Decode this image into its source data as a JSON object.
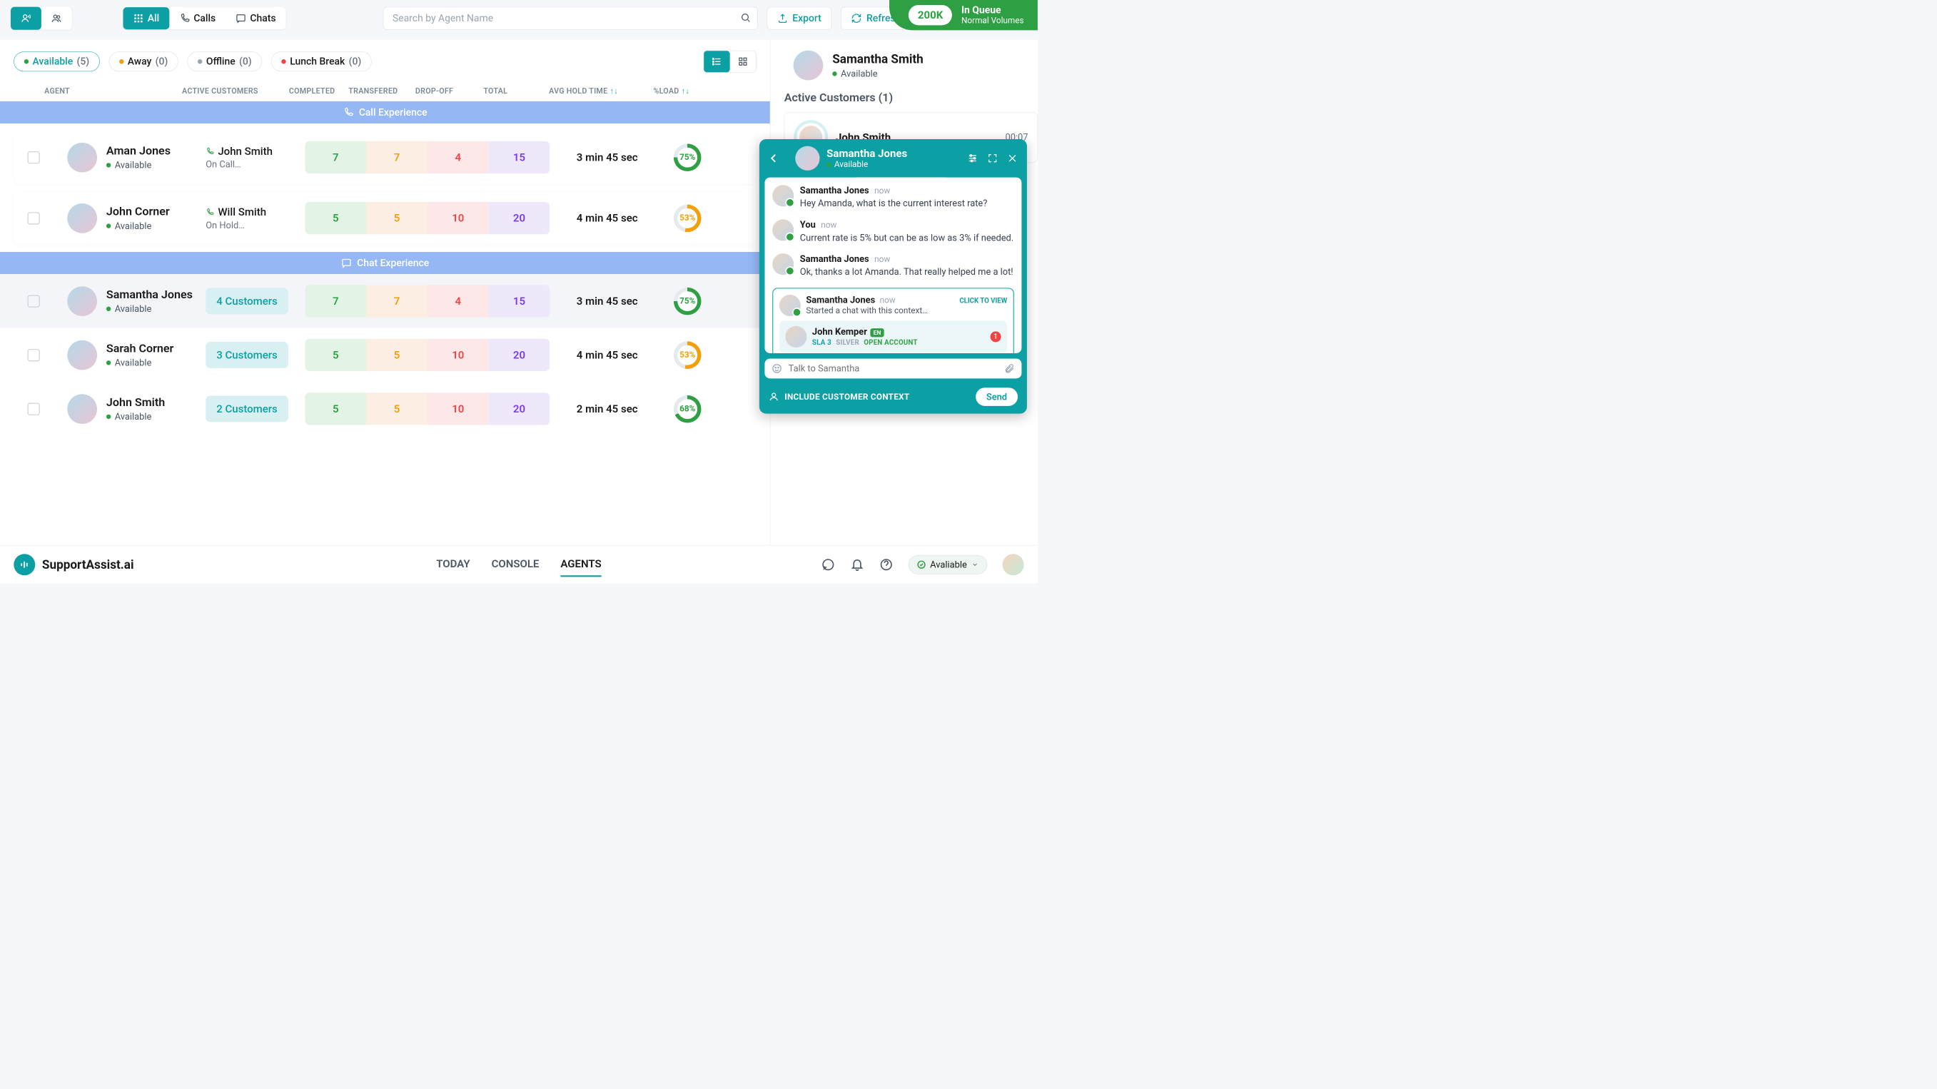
{
  "topbar": {
    "search_placeholder": "Search by Agent Name",
    "filter_all": "All",
    "filter_calls": "Calls",
    "filter_chats": "Chats",
    "export": "Export",
    "refresh": "Refresh"
  },
  "queue": {
    "count": "200K",
    "title": "In Queue",
    "sub": "Normal Volumes"
  },
  "status_filters": [
    {
      "label": "Available",
      "count": "(5)",
      "dot": "dot-green",
      "active": true
    },
    {
      "label": "Away",
      "count": "(0)",
      "dot": "dot-orange",
      "active": false
    },
    {
      "label": "Offline",
      "count": "(0)",
      "dot": "dot-gray",
      "active": false
    },
    {
      "label": "Lunch Break",
      "count": "(0)",
      "dot": "dot-red",
      "active": false
    }
  ],
  "columns": {
    "agent": "AGENT",
    "active": "ACTIVE CUSTOMERS",
    "completed": "COMPLETED",
    "transfered": "TRANSFERED",
    "dropoff": "DROP-OFF",
    "total": "TOTAL",
    "hold": "AVG HOLD TIME",
    "load": "%LOAD"
  },
  "sections": {
    "call": "Call Experience",
    "chat": "Chat Experience"
  },
  "agents_call": [
    {
      "name": "Aman Jones",
      "status": "Available",
      "customer_name": "John Smith",
      "customer_status": "On Call…",
      "metrics": {
        "completed": "7",
        "transfered": "7",
        "dropoff": "4",
        "total": "15"
      },
      "hold": "3 min 45 sec",
      "load": "75%",
      "load_pct": 75,
      "ring_col": "#2ea043"
    },
    {
      "name": "John Corner",
      "status": "Available",
      "customer_name": "Will Smith",
      "customer_status": "On Hold…",
      "metrics": {
        "completed": "5",
        "transfered": "5",
        "dropoff": "10",
        "total": "20"
      },
      "hold": "4 min 45 sec",
      "load": "53%",
      "load_pct": 53,
      "ring_col": "#f59e0b"
    }
  ],
  "agents_chat": [
    {
      "name": "Samantha Jones",
      "status": "Available",
      "customer_pill": "4 Customers",
      "metrics": {
        "completed": "7",
        "transfered": "7",
        "dropoff": "4",
        "total": "15"
      },
      "hold": "3 min 45 sec",
      "load": "75%",
      "load_pct": 75,
      "ring_col": "#2ea043",
      "shade": true
    },
    {
      "name": "Sarah Corner",
      "status": "Available",
      "customer_pill": "3 Customers",
      "metrics": {
        "completed": "5",
        "transfered": "5",
        "dropoff": "10",
        "total": "20"
      },
      "hold": "4 min 45 sec",
      "load": "53%",
      "load_pct": 53,
      "ring_col": "#f59e0b"
    },
    {
      "name": "John Smith",
      "status": "Available",
      "customer_pill": "2 Customers",
      "metrics": {
        "completed": "5",
        "transfered": "5",
        "dropoff": "10",
        "total": "20"
      },
      "hold": "2 min 45 sec",
      "load": "68%",
      "load_pct": 68,
      "ring_col": "#2ea043"
    }
  ],
  "right_panel": {
    "agent_name": "Samantha Smith",
    "agent_status": "Available",
    "section_title": "Active Customers (1)",
    "customer_name": "John Smith",
    "customer_time": "00:07"
  },
  "chat": {
    "header_name": "Samantha Jones",
    "header_status": "Available",
    "messages": [
      {
        "name": "Samantha Jones",
        "time": "now",
        "text": "Hey Amanda, what is the current interest rate?"
      },
      {
        "name": "You",
        "time": "now",
        "text": "Current rate is 5% but can be as low as 3% if needed."
      },
      {
        "name": "Samantha Jones",
        "time": "now",
        "text": "Ok, thanks a lot Amanda. That really helped me a lot!"
      }
    ],
    "context": {
      "author": "Samantha Jones",
      "time": "now",
      "click_label": "CLICK TO VIEW",
      "started": "Started a chat with this context…",
      "customer": "John Kemper",
      "lang": "EN",
      "tag_sla": "SLA 3",
      "tag_tier": "SILVER",
      "tag_action": "OPEN ACCOUNT",
      "badge": "1"
    },
    "input_placeholder": "Talk to Samantha",
    "include_label": "INCLUDE CUSTOMER CONTEXT",
    "send": "Send"
  },
  "bottom": {
    "brand": "SupportAssist.ai",
    "tabs": {
      "today": "TODAY",
      "console": "CONSOLE",
      "agents": "AGENTS"
    },
    "status": "Avaliable"
  }
}
